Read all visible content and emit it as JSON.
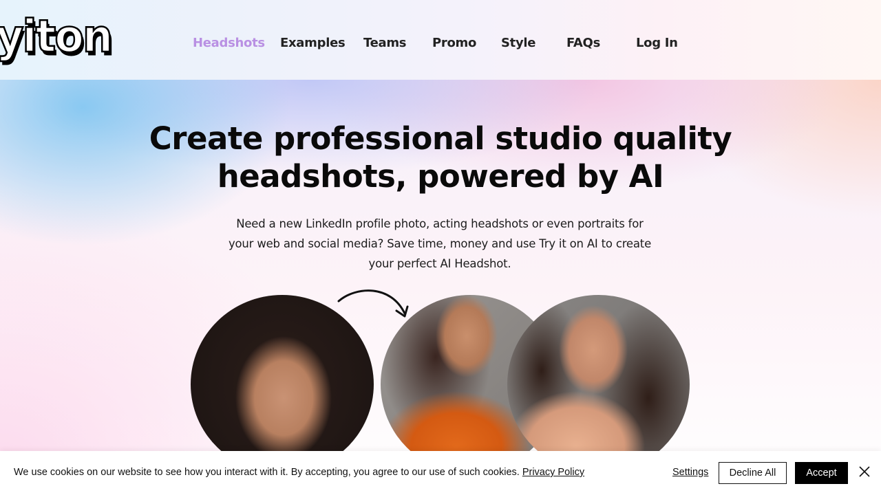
{
  "header": {
    "logo_text": "yiton",
    "nav": [
      {
        "label": "Headshots",
        "active": true
      },
      {
        "label": "Examples",
        "active": false
      },
      {
        "label": "Teams",
        "active": false
      },
      {
        "label": "Promo",
        "active": false
      },
      {
        "label": "Style",
        "active": false
      },
      {
        "label": "FAQs",
        "active": false
      },
      {
        "label": "Log In",
        "active": false
      }
    ],
    "active_color": "#b990e3"
  },
  "hero": {
    "headline_line1": "Create professional studio quality",
    "headline_line2": "headshots, powered by AI",
    "subtitle_line1": "Need a new LinkedIn profile photo, acting headshots or even portraits for",
    "subtitle_line2": "your web and social media? Save time, money and use Try it on AI to create",
    "subtitle_line3": "your perfect AI Headshot.",
    "photos": [
      {
        "alt": "Original selfie photo"
      },
      {
        "alt": "AI headshot in orange blazer"
      },
      {
        "alt": "AI headshot in formal dress"
      }
    ],
    "arrow_icon": "curved-arrow-right"
  },
  "cookie_banner": {
    "message": "We use cookies on our website to see how you interact with it. By accepting, you agree to our use of such cookies.",
    "privacy_link": "Privacy Policy",
    "settings_label": "Settings",
    "decline_label": "Decline All",
    "accept_label": "Accept",
    "close_icon": "close-x"
  }
}
